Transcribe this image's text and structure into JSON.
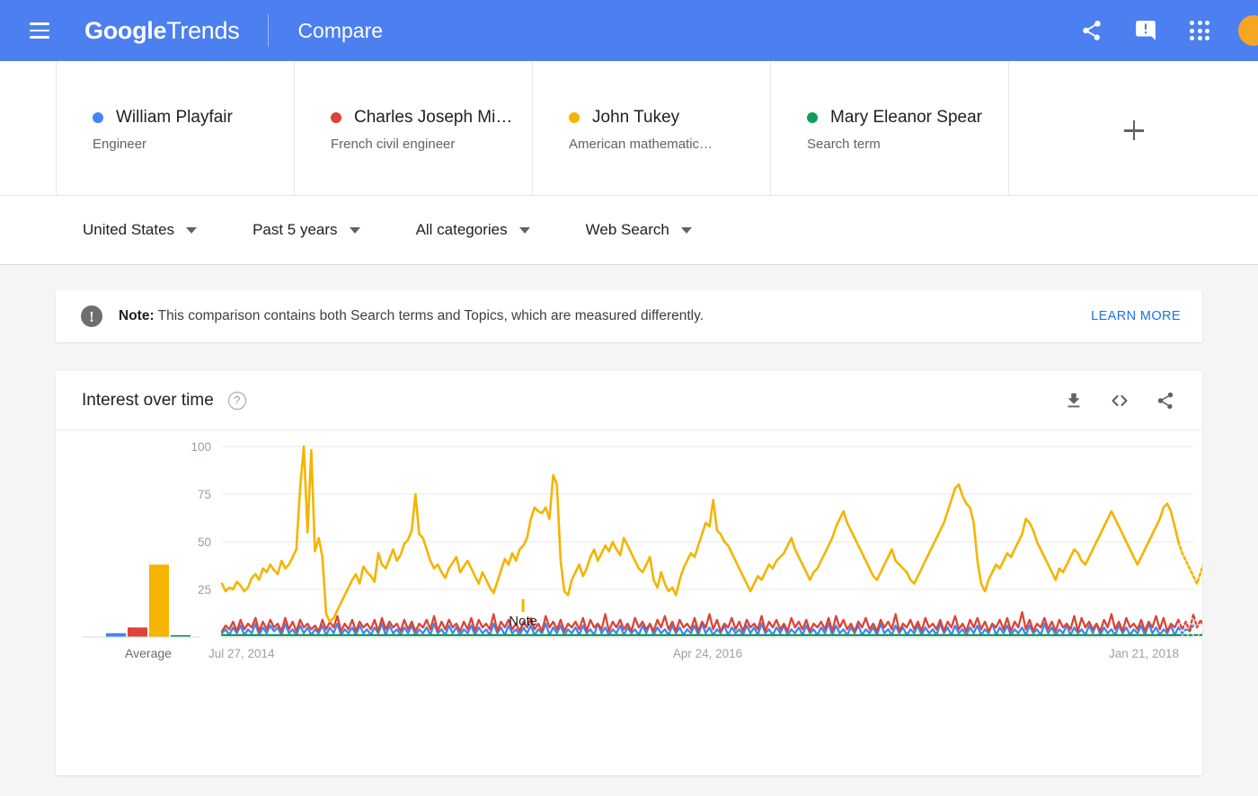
{
  "header": {
    "menu_icon": "hamburger-icon",
    "brand_google": "Google",
    "brand_trends": "Trends",
    "section": "Compare",
    "share_icon": "share-icon",
    "feedback_icon": "feedback-icon",
    "apps_icon": "apps-grid-icon",
    "avatar": "user-avatar"
  },
  "compare_cards": [
    {
      "name": "William Playfair",
      "subtitle": "Engineer",
      "color": "#4285f4"
    },
    {
      "name": "Charles Joseph Mi…",
      "subtitle": "French civil engineer",
      "color": "#db4437"
    },
    {
      "name": "John Tukey",
      "subtitle": "American mathematic…",
      "color": "#f4b400"
    },
    {
      "name": "Mary Eleanor Spear",
      "subtitle": "Search term",
      "color": "#0f9d58"
    }
  ],
  "add_term_label": "+",
  "filters": [
    {
      "label": "United States"
    },
    {
      "label": "Past 5 years"
    },
    {
      "label": "All categories"
    },
    {
      "label": "Web Search"
    }
  ],
  "note": {
    "badge": "!",
    "prefix": "Note:",
    "body": " This comparison contains both Search terms and Topics, which are measured differently.",
    "learn_more": "LEARN MORE"
  },
  "chart_panel": {
    "title": "Interest over time",
    "help_icon": "help-circle-icon",
    "download_icon": "download-icon",
    "embed_icon": "embed-code-icon",
    "share_icon": "share-icon"
  },
  "chart_data": {
    "type": "line",
    "title": "Interest over time",
    "xlabel": "",
    "ylabel": "",
    "ylim": [
      0,
      100
    ],
    "yticks": [
      25,
      50,
      75,
      100
    ],
    "grid": true,
    "legend_position": "top-cards",
    "xtick_labels": [
      "Jul 27, 2014",
      "Apr 24, 2016",
      "Jan 21, 2018"
    ],
    "xtick_positions": [
      0.0,
      0.5,
      1.0
    ],
    "annotation": "Note",
    "annotation_x": 0.31,
    "average_label": "Average",
    "averages": [
      2,
      5,
      38,
      1
    ],
    "series": [
      {
        "name": "William Playfair",
        "color": "#4285f4",
        "values": [
          2,
          4,
          1,
          5,
          2,
          6,
          1,
          4,
          2,
          7,
          1,
          5,
          2,
          6,
          3,
          5,
          1,
          7,
          2,
          4,
          1,
          6,
          2,
          5,
          1,
          4,
          2,
          6,
          1,
          5,
          2,
          7,
          1,
          4,
          2,
          5,
          1,
          6,
          2,
          4,
          1,
          5,
          2,
          7,
          1,
          6,
          2,
          4,
          1,
          5,
          2,
          6,
          1,
          4,
          2,
          5,
          1,
          7,
          2,
          4,
          1,
          6,
          2,
          5,
          1,
          4,
          2,
          6,
          1,
          5,
          2,
          4,
          1,
          7,
          2,
          5,
          1,
          6,
          2,
          4,
          1,
          5,
          2,
          6,
          1,
          4,
          2,
          7,
          1,
          5,
          2,
          6,
          1,
          4,
          2,
          5,
          1,
          6,
          2,
          4,
          1,
          7,
          2,
          5,
          1,
          4,
          2,
          6,
          1,
          5,
          2,
          4,
          1,
          6,
          2,
          7,
          1,
          5,
          2,
          4,
          1,
          6,
          2,
          5,
          1,
          4,
          2,
          6,
          1,
          7,
          2,
          5,
          1,
          4,
          2,
          6,
          1,
          5,
          2,
          4,
          1,
          6,
          2,
          5,
          1,
          7,
          2,
          4,
          1,
          5,
          2,
          6,
          1,
          4,
          2,
          5,
          1,
          6,
          2,
          4,
          1,
          5,
          2,
          7,
          1,
          6,
          2,
          4,
          1,
          5,
          2,
          6,
          1,
          4,
          2,
          5,
          1,
          7,
          2,
          4,
          1,
          6,
          2,
          5,
          1,
          4,
          2,
          6,
          1,
          5,
          2,
          4,
          1,
          7,
          2,
          5,
          1,
          6,
          2,
          4,
          1,
          5,
          2,
          6,
          1,
          4,
          2,
          7,
          1,
          5,
          2,
          6,
          1,
          4,
          2,
          5,
          1,
          6,
          2,
          4,
          1,
          7,
          2,
          5,
          1,
          4,
          2,
          6,
          1,
          5,
          2,
          4,
          1,
          6,
          2,
          7,
          1,
          5,
          2,
          4,
          1,
          6,
          2,
          5,
          1,
          4,
          2,
          6,
          1,
          7,
          2,
          5,
          1,
          4,
          2,
          6,
          1,
          5,
          2,
          4,
          3,
          6
        ]
      },
      {
        "name": "Charles Joseph Minard",
        "color": "#db4437",
        "values": [
          3,
          6,
          4,
          8,
          3,
          9,
          4,
          7,
          5,
          10,
          3,
          8,
          4,
          9,
          5,
          7,
          3,
          10,
          4,
          8,
          3,
          9,
          5,
          7,
          4,
          6,
          3,
          9,
          4,
          8,
          5,
          11,
          3,
          7,
          4,
          9,
          3,
          8,
          5,
          7,
          4,
          9,
          3,
          10,
          4,
          8,
          5,
          7,
          3,
          9,
          4,
          8,
          3,
          7,
          5,
          9,
          4,
          11,
          3,
          8,
          4,
          9,
          5,
          7,
          3,
          8,
          4,
          10,
          3,
          9,
          5,
          7,
          4,
          12,
          3,
          8,
          5,
          9,
          4,
          7,
          3,
          8,
          5,
          10,
          4,
          7,
          3,
          11,
          5,
          8,
          4,
          9,
          3,
          7,
          5,
          8,
          4,
          10,
          3,
          9,
          5,
          7,
          4,
          12,
          3,
          8,
          5,
          9,
          4,
          7,
          3,
          10,
          5,
          8,
          4,
          7,
          3,
          9,
          5,
          11,
          4,
          8,
          3,
          9,
          5,
          7,
          4,
          10,
          3,
          8,
          5,
          12,
          4,
          9,
          3,
          7,
          5,
          10,
          4,
          8,
          3,
          9,
          5,
          7,
          4,
          11,
          3,
          8,
          5,
          9,
          4,
          7,
          3,
          10,
          5,
          8,
          4,
          9,
          3,
          7,
          5,
          8,
          4,
          10,
          3,
          11,
          5,
          9,
          4,
          7,
          3,
          8,
          5,
          10,
          4,
          7,
          3,
          9,
          5,
          8,
          4,
          12,
          3,
          7,
          5,
          9,
          4,
          8,
          3,
          10,
          5,
          7,
          4,
          9,
          3,
          8,
          5,
          11,
          4,
          7,
          3,
          9,
          5,
          10,
          4,
          8,
          3,
          7,
          5,
          9,
          4,
          10,
          3,
          8,
          5,
          13,
          4,
          9,
          3,
          7,
          5,
          10,
          4,
          8,
          3,
          9,
          5,
          7,
          4,
          11,
          3,
          10,
          5,
          8,
          4,
          7,
          3,
          9,
          5,
          12,
          4,
          8,
          3,
          10,
          5,
          7,
          4,
          9,
          3,
          8,
          5,
          11,
          4,
          10,
          3,
          7,
          5,
          9,
          4,
          8,
          3,
          12,
          5,
          9,
          4,
          7,
          3,
          10,
          5,
          8,
          4,
          9,
          6,
          13
        ]
      },
      {
        "name": "John Tukey",
        "color": "#f4b400",
        "values": [
          28,
          24,
          26,
          25,
          29,
          27,
          24,
          26,
          31,
          33,
          30,
          36,
          34,
          38,
          35,
          33,
          40,
          36,
          38,
          42,
          46,
          78,
          100,
          55,
          98,
          45,
          52,
          42,
          12,
          8,
          10,
          14,
          18,
          22,
          26,
          30,
          33,
          28,
          37,
          34,
          32,
          29,
          44,
          38,
          36,
          41,
          46,
          40,
          43,
          49,
          51,
          56,
          75,
          54,
          52,
          46,
          40,
          36,
          38,
          34,
          31,
          36,
          39,
          42,
          34,
          37,
          40,
          36,
          32,
          28,
          34,
          30,
          26,
          23,
          29,
          35,
          41,
          38,
          44,
          40,
          46,
          48,
          52,
          62,
          68,
          66,
          65,
          68,
          62,
          85,
          80,
          40,
          24,
          22,
          30,
          34,
          38,
          32,
          36,
          42,
          46,
          40,
          44,
          48,
          45,
          50,
          46,
          43,
          52,
          48,
          44,
          40,
          36,
          34,
          38,
          42,
          30,
          26,
          34,
          28,
          24,
          26,
          22,
          30,
          36,
          40,
          44,
          42,
          48,
          54,
          60,
          58,
          72,
          56,
          54,
          50,
          48,
          44,
          40,
          36,
          32,
          28,
          24,
          28,
          32,
          30,
          34,
          38,
          36,
          40,
          42,
          44,
          48,
          52,
          46,
          42,
          38,
          34,
          30,
          34,
          36,
          40,
          44,
          48,
          52,
          58,
          62,
          66,
          60,
          56,
          52,
          48,
          44,
          40,
          36,
          32,
          30,
          34,
          38,
          42,
          46,
          40,
          38,
          36,
          34,
          30,
          28,
          32,
          36,
          40,
          44,
          48,
          52,
          56,
          60,
          66,
          72,
          78,
          80,
          74,
          70,
          68,
          60,
          40,
          28,
          24,
          30,
          34,
          38,
          36,
          40,
          44,
          42,
          46,
          50,
          54,
          62,
          60,
          56,
          50,
          46,
          42,
          38,
          34,
          30,
          36,
          34,
          38,
          42,
          46,
          44,
          40,
          38,
          42,
          46,
          50,
          54,
          58,
          62,
          66,
          62,
          58,
          54,
          50,
          46,
          42,
          38,
          42,
          46,
          50,
          54,
          58,
          62,
          68,
          70,
          66,
          58,
          50,
          44,
          40,
          36,
          32,
          28,
          34,
          40,
          46,
          52,
          56,
          50,
          44,
          40,
          46,
          52,
          58,
          62,
          70,
          66,
          58,
          50,
          42,
          38,
          34,
          30,
          36,
          40,
          44,
          38,
          34,
          30,
          26,
          32,
          38,
          42,
          36,
          30,
          26,
          30,
          36,
          34
        ]
      },
      {
        "name": "Mary Eleanor Spear",
        "color": "#0f9d58",
        "values": [
          1,
          1,
          1,
          1,
          1,
          1,
          1,
          1,
          1,
          1,
          1,
          1,
          1,
          1,
          1,
          1,
          1,
          1,
          1,
          1,
          1,
          1,
          1,
          1,
          1,
          1,
          1,
          1,
          1,
          1,
          1,
          1,
          1,
          1,
          1,
          1,
          1,
          1,
          1,
          1,
          1,
          1,
          1,
          1,
          1,
          1,
          1,
          1,
          1,
          1,
          1,
          1,
          1,
          1,
          1,
          1,
          1,
          1,
          1,
          1,
          1,
          1,
          1,
          1,
          1,
          1,
          1,
          1,
          1,
          1,
          1,
          1,
          1,
          1,
          1,
          1,
          1,
          1,
          1,
          1,
          1,
          1,
          1,
          1,
          1,
          1,
          1,
          1,
          1,
          1,
          1,
          1,
          1,
          1,
          1,
          1,
          1,
          1,
          1,
          1,
          1,
          1,
          1,
          1,
          1,
          1,
          1,
          1,
          1,
          1,
          1,
          1,
          1,
          1,
          1,
          1,
          1,
          1,
          1,
          1,
          1,
          1,
          1,
          1,
          1,
          1,
          1,
          1,
          1,
          1,
          1,
          1,
          1,
          1,
          1,
          1,
          1,
          1,
          1,
          1,
          1,
          1,
          1,
          1,
          1,
          1,
          1,
          1,
          1,
          1,
          1,
          1,
          1,
          1,
          1,
          1,
          1,
          1,
          1,
          1,
          1,
          1,
          1,
          1,
          1,
          1,
          1,
          1,
          1,
          1,
          1,
          1,
          1,
          1,
          1,
          1,
          1,
          1,
          1,
          1,
          1,
          1,
          1,
          1,
          1,
          1,
          1,
          1,
          1,
          1,
          1,
          1,
          1,
          1,
          1,
          1,
          1,
          1,
          1,
          1,
          1,
          1,
          1,
          1,
          1,
          1,
          1,
          1,
          1,
          1,
          1,
          1,
          1,
          1,
          1,
          1,
          1,
          1,
          1,
          1,
          1,
          1,
          1,
          1,
          1,
          1,
          1,
          1,
          1,
          1,
          1,
          1,
          1,
          1,
          1,
          1,
          1,
          1,
          1,
          1,
          1,
          1,
          1,
          1,
          1,
          1,
          1,
          1,
          1,
          1,
          1,
          1,
          1,
          1,
          1,
          1,
          1,
          1,
          1,
          1,
          1,
          1,
          1,
          1,
          1,
          1,
          1,
          1,
          1,
          1
        ]
      }
    ]
  }
}
